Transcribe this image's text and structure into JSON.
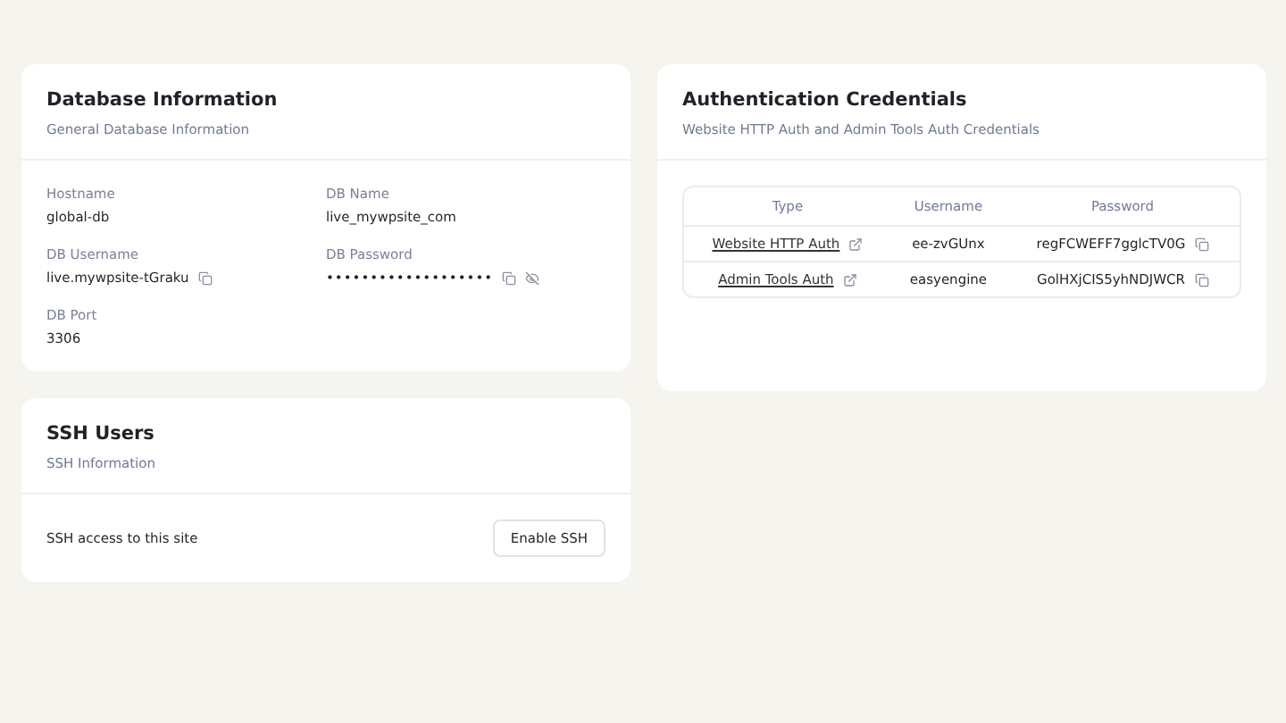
{
  "database": {
    "title": "Database Information",
    "subtitle": "General Database Information",
    "fields": [
      {
        "label": "Hostname",
        "value": "global-db",
        "copy": false,
        "masked": false
      },
      {
        "label": "DB Name",
        "value": "live_mywpsite_com",
        "copy": false,
        "masked": false
      },
      {
        "label": "DB Username",
        "value": "live.mywpsite-tGraku",
        "copy": true,
        "masked": false
      },
      {
        "label": "DB Password",
        "value": "•••••••••••••••••••",
        "copy": true,
        "masked": true
      },
      {
        "label": "DB Port",
        "value": "3306",
        "copy": false,
        "masked": false
      }
    ]
  },
  "ssh": {
    "title": "SSH Users",
    "subtitle": "SSH Information",
    "description": "SSH access to this site",
    "button": "Enable SSH"
  },
  "auth": {
    "title": "Authentication Credentials",
    "subtitle": "Website HTTP Auth and Admin Tools Auth Credentials",
    "columns": [
      "Type",
      "Username",
      "Password"
    ],
    "rows": [
      {
        "type": "Website HTTP Auth",
        "username": "ee-zvGUnx",
        "password": "regFCWEFF7gglcTV0G"
      },
      {
        "type": "Admin Tools Auth",
        "username": "easyengine",
        "password": "GolHXjCIS5yhNDJWCR"
      }
    ]
  }
}
